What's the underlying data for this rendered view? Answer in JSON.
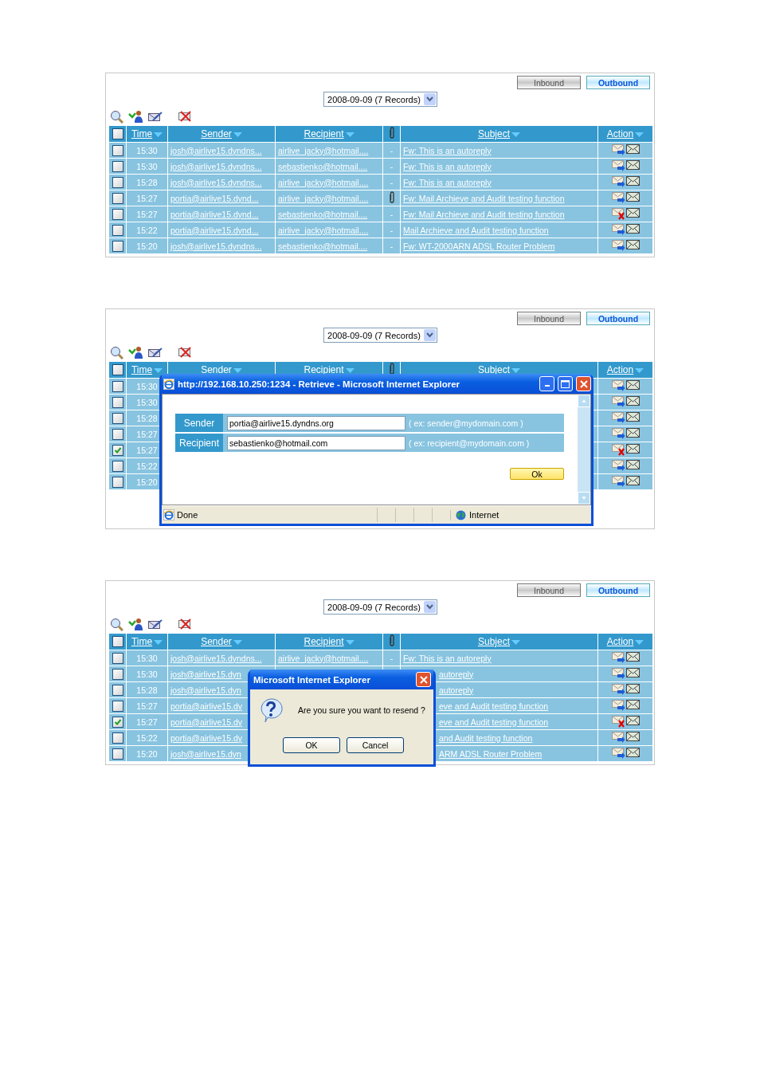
{
  "panels": [
    {
      "tabs": [
        {
          "label": "Inbound",
          "selected": false
        },
        {
          "label": "Outbound",
          "selected": true
        }
      ],
      "date_select": {
        "value": "2008-09-09 (7 Records)"
      },
      "table": {
        "select_all_checked": false,
        "columns": [
          "Time",
          "Sender",
          "Recipient",
          "Subject",
          "Action"
        ],
        "rows": [
          {
            "kind": "full",
            "checked": false,
            "time": "15:30",
            "sender": "josh@airlive15.dyndns...",
            "recipient": "airlive_jacky@hotmail....",
            "attachment": false,
            "attach_label": "-",
            "subject": "Fw: This is an autoreply",
            "error": false
          },
          {
            "kind": "full",
            "checked": false,
            "time": "15:30",
            "sender": "josh@airlive15.dyndns...",
            "recipient": "sebastienko@hotmail....",
            "attachment": false,
            "attach_label": "-",
            "subject": "Fw: This is an autoreply",
            "error": false
          },
          {
            "kind": "full",
            "checked": false,
            "time": "15:28",
            "sender": "josh@airlive15.dyndns...",
            "recipient": "airlive_jacky@hotmail....",
            "attachment": false,
            "attach_label": "-",
            "subject": "Fw: This is an autoreply",
            "error": false
          },
          {
            "kind": "full",
            "checked": false,
            "time": "15:27",
            "sender": "portia@airlive15.dynd...",
            "recipient": "airlive_jacky@hotmail....",
            "attachment": true,
            "subject": "Fw: Mail Archieve and Audit testing function",
            "error": false
          },
          {
            "kind": "full",
            "checked": false,
            "time": "15:27",
            "sender": "portia@airlive15.dynd...",
            "recipient": "sebastienko@hotmail....",
            "attachment": false,
            "attach_label": "-",
            "subject": "Fw: Mail Archieve and Audit testing function",
            "error": true
          },
          {
            "kind": "full",
            "checked": false,
            "time": "15:22",
            "sender": "portia@airlive15.dynd...",
            "recipient": "airlive_jacky@hotmail....",
            "attachment": false,
            "attach_label": "-",
            "subject": "Mail Archieve and Audit testing function",
            "error": false
          },
          {
            "kind": "full",
            "checked": false,
            "time": "15:20",
            "sender": "josh@airlive15.dyndns...",
            "recipient": "sebastienko@hotmail....",
            "attachment": false,
            "attach_label": "-",
            "subject": "Fw: WT-2000ARN ADSL Router Problem",
            "error": false
          }
        ]
      }
    },
    {
      "tabs": [
        {
          "label": "Inbound",
          "selected": false
        },
        {
          "label": "Outbound",
          "selected": true
        }
      ],
      "date_select": {
        "value": "2008-09-09 (7 Records)"
      },
      "table": {
        "select_all_checked": false,
        "columns": [
          "Time",
          "Sender",
          "Recipient",
          "Subject",
          "Action"
        ],
        "rows": [
          {
            "kind": "covered",
            "checked": false,
            "time": "15:30",
            "error": false
          },
          {
            "kind": "covered",
            "checked": false,
            "time": "15:30",
            "error": false
          },
          {
            "kind": "covered",
            "checked": false,
            "time": "15:28",
            "error": false
          },
          {
            "kind": "covered",
            "checked": false,
            "time": "15:27",
            "error": false
          },
          {
            "kind": "covered",
            "checked": true,
            "time": "15:27",
            "error": true
          },
          {
            "kind": "covered",
            "checked": false,
            "time": "15:22",
            "error": false
          },
          {
            "kind": "covered",
            "checked": false,
            "time": "15:20",
            "error": false
          }
        ]
      },
      "overlay": {
        "kind": "window",
        "title": "http://192.168.10.250:1234 - Retrieve - Microsoft Internet Explorer",
        "fields": [
          {
            "label": "Sender",
            "value": "portia@airlive15.dyndns.org",
            "hint": "( ex: sender@mydomain.com )"
          },
          {
            "label": "Recipient",
            "value": "sebastienko@hotmail.com",
            "hint": "( ex: recipient@mydomain.com )"
          }
        ],
        "ok_button": "Ok",
        "status": "Done",
        "zone": "Internet"
      }
    },
    {
      "tabs": [
        {
          "label": "Inbound",
          "selected": false
        },
        {
          "label": "Outbound",
          "selected": true
        }
      ],
      "date_select": {
        "value": "2008-09-09 (7 Records)"
      },
      "table": {
        "select_all_checked": false,
        "columns": [
          "Time",
          "Sender",
          "Recipient",
          "Subject",
          "Action"
        ],
        "rows": [
          {
            "kind": "full",
            "checked": false,
            "time": "15:30",
            "sender": "josh@airlive15.dyndns...",
            "recipient": "airlive_jacky@hotmail....",
            "attachment": false,
            "attach_label": "-",
            "subject": "Fw: This is an autoreply",
            "error": false
          },
          {
            "kind": "partial",
            "checked": false,
            "time": "15:30",
            "sender": "josh@airlive15.dyn",
            "subject": "autoreply",
            "error": false
          },
          {
            "kind": "partial",
            "checked": false,
            "time": "15:28",
            "sender": "josh@airlive15.dyn",
            "subject": "autoreply",
            "error": false
          },
          {
            "kind": "partial",
            "checked": false,
            "time": "15:27",
            "sender": "portia@airlive15.dy",
            "subject": "eve and Audit testing function",
            "error": false
          },
          {
            "kind": "partial",
            "checked": true,
            "time": "15:27",
            "sender": "portia@airlive15.dy",
            "subject": "eve and Audit testing function",
            "error": true
          },
          {
            "kind": "partial",
            "checked": false,
            "time": "15:22",
            "sender": "portia@airlive15.dy",
            "subject": "and Audit testing function",
            "error": false
          },
          {
            "kind": "partial",
            "checked": false,
            "time": "15:20",
            "sender": "josh@airlive15.dyn",
            "subject": "ARM ADSL Router Problem",
            "error": false
          }
        ]
      },
      "overlay": {
        "kind": "dialog",
        "title": "Microsoft Internet Explorer",
        "message": "Are you sure you want to resend ?",
        "buttons": [
          "OK",
          "Cancel"
        ]
      }
    }
  ]
}
